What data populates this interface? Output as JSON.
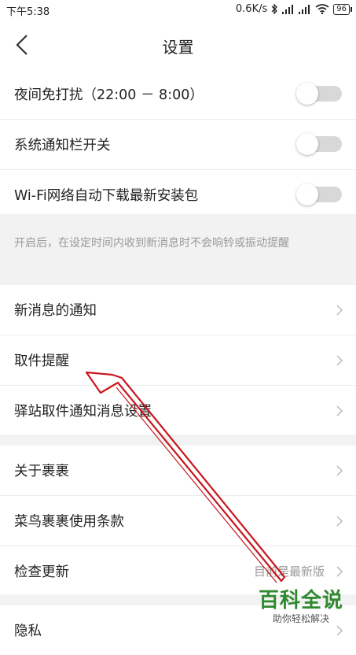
{
  "status_bar": {
    "time": "下午5:38",
    "speed": "0.6K/s",
    "battery": "96"
  },
  "header": {
    "title": "设置"
  },
  "toggles": [
    {
      "label": "夜间免打扰（22:00 － 8:00）",
      "on": false
    },
    {
      "label": "系统通知栏开关",
      "on": false
    },
    {
      "label": "Wi-Fi网络自动下载最新安装包",
      "on": false
    }
  ],
  "hint": "开启后，在设定时间内收到新消息时不会响铃或振动提醒",
  "notify_items": [
    {
      "label": "新消息的通知"
    },
    {
      "label": "取件提醒"
    },
    {
      "label": "驿站取件通知消息设置"
    }
  ],
  "about_items": [
    {
      "label": "关于裹裹"
    },
    {
      "label": "菜鸟裹裹使用条款"
    },
    {
      "label": "检查更新",
      "value": "目前是最新版"
    }
  ],
  "privacy_items": [
    {
      "label": "隐私"
    }
  ],
  "watermark": {
    "logo": "百科全说",
    "sub": "助你轻松解决"
  },
  "colors": {
    "toggle_off": "#d8d8d8",
    "section_gap": "#f2f2f2",
    "arrow": "#c8171e",
    "watermark_green": "#2f8a2f"
  }
}
